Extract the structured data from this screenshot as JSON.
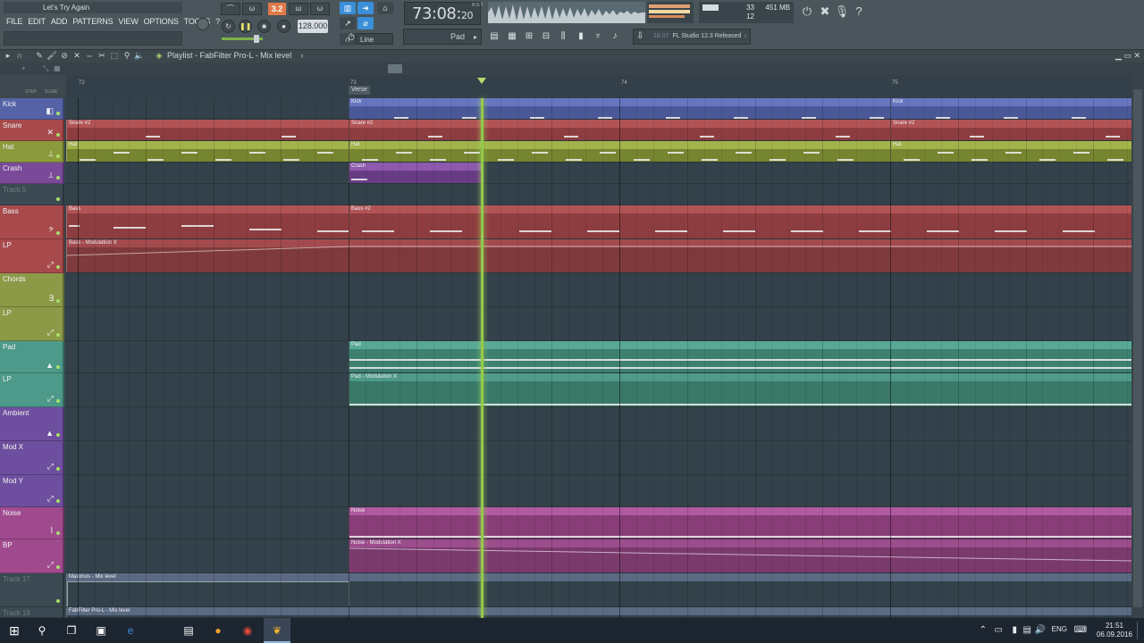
{
  "window": {
    "project_title": "Let's Try Again"
  },
  "menu": [
    "FILE",
    "EDIT",
    "ADD",
    "PATTERNS",
    "VIEW",
    "OPTIONS",
    "TOOLS",
    "?"
  ],
  "toolbar": {
    "pattern_number": "3.2",
    "tempo": "128.000",
    "line_mode": "Line",
    "time": "73:08",
    "time_ticks": "20",
    "time_unit": "B:S:T",
    "cpu": "33",
    "memory": "451 MB",
    "polyphony": "12",
    "current_channel": "Pad",
    "news_date": "18.07",
    "news_text": "FL Studio 12.3 Released"
  },
  "playlist": {
    "title": "Playlist - FabFilter Pro-L - Mix level",
    "step_label": "STEP",
    "slide_label": "SLIDE",
    "bar_numbers": [
      "72",
      "73",
      "74",
      "75"
    ],
    "marker": "Verse"
  },
  "tracks": [
    {
      "name": "Kick",
      "color": "#5563a6"
    },
    {
      "name": "Snare",
      "color": "#a84a4c"
    },
    {
      "name": "Hat",
      "color": "#8b9a3c"
    },
    {
      "name": "Crash",
      "color": "#7a4a98"
    },
    {
      "name": "Track 5",
      "color": "#3b4a52"
    },
    {
      "name": "Bass",
      "color": "#a84a4c"
    },
    {
      "name": "LP",
      "color": "#a84a4c"
    },
    {
      "name": "Chords",
      "color": "#8c9a48"
    },
    {
      "name": "LP",
      "color": "#8c9a48"
    },
    {
      "name": "Pad",
      "color": "#4d9a8a"
    },
    {
      "name": "LP",
      "color": "#4d9a8a"
    },
    {
      "name": "Ambient",
      "color": "#6e4e9e"
    },
    {
      "name": "Mod X",
      "color": "#6e4e9e"
    },
    {
      "name": "Mod Y",
      "color": "#6e4e9e"
    },
    {
      "name": "Noise",
      "color": "#a04a8e"
    },
    {
      "name": "BP",
      "color": "#a04a8e"
    },
    {
      "name": "Track 17",
      "color": "#3b4a52"
    },
    {
      "name": "Track 18",
      "color": "#3b4a52"
    }
  ],
  "clips": {
    "kick": "Kick",
    "snare": "Snare #2",
    "hat": "Hat",
    "crash": "Crash",
    "bass": "Bass",
    "bass2": "Bass #2",
    "bass_mod": "Bass - Modulation X",
    "pad": "Pad",
    "pad_mod": "Pad - Modulation X",
    "noise": "Noise",
    "noise_mod": "Noise - Modulation X",
    "maximus": "Maximus - Mix level",
    "fabfilter": "FabFilter Pro-L - Mix level"
  },
  "taskbar": {
    "language": "ENG",
    "time": "21:51",
    "date": "06.09.2016"
  }
}
